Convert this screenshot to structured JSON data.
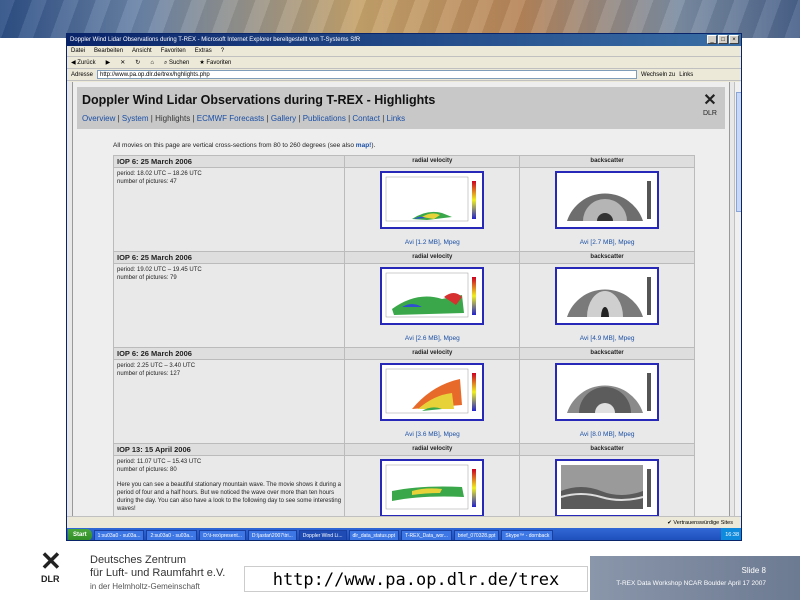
{
  "window": {
    "title": "Doppler Wind Lidar Observations during T-REX - Microsoft Internet Explorer bereitgestellt von T-Systems SfR",
    "controls": [
      "_",
      "□",
      "×"
    ]
  },
  "menu": [
    "Datei",
    "Bearbeiten",
    "Ansicht",
    "Favoriten",
    "Extras",
    "?"
  ],
  "toolbar": {
    "back": "Zurück",
    "search": "Suchen",
    "favorites": "Favoriten"
  },
  "address": {
    "label": "Adresse",
    "url": "http://www.pa.op.dlr.de/trex/hghlights.php",
    "go": "Wechseln zu",
    "links": "Links"
  },
  "page": {
    "title": "Doppler Wind Lidar Observations during T-REX - Highlights",
    "nav": [
      "Overview",
      "System",
      "Highlights",
      "ECMWF Forecasts",
      "Gallery",
      "Publications",
      "Contact",
      "Links"
    ],
    "logo_text": "DLR",
    "intro": "All movies on this page are vertical cross-sections from 80 to 260 degrees (see also",
    "intro_link": "map!",
    "intro_end": ").",
    "col_radial": "radial velocity",
    "col_backscatter": "backscatter",
    "iops": [
      {
        "name": "IOP 6: 25 March 2006",
        "period": "period: 18.02 UTC – 18.26 UTC",
        "pictures": "number of pictures: 47",
        "note": "",
        "radial_avi": "Avi [1.2 MB]",
        "back_avi": "Avi [2.7 MB]",
        "mpeg": "Mpeg"
      },
      {
        "name": "IOP 6: 25 March 2006",
        "period": "period: 19.02 UTC – 19.45 UTC",
        "pictures": "number of pictures: 79",
        "note": "",
        "radial_avi": "Avi [2.6 MB]",
        "back_avi": "Avi [4.9 MB]",
        "mpeg": "Mpeg"
      },
      {
        "name": "IOP 6: 26 March 2006",
        "period": "period: 2.25 UTC – 3.40 UTC",
        "pictures": "number of pictures: 127",
        "note": "",
        "radial_avi": "Avi [3.6 MB]",
        "back_avi": "Avi [8.0 MB]",
        "mpeg": "Mpeg"
      },
      {
        "name": "IOP 13: 15 April 2006",
        "period": "period: 11.07 UTC – 15.43 UTC",
        "pictures": "number of pictures: 80",
        "note": "Here you can see a beautiful stationary mountain wave. The movie shows it during a period of four and a half hours. But we noticed the wave over more than ten hours during the day. You can also have a look to the following day to see some interesting waves!",
        "radial_avi": "",
        "back_avi": "",
        "mpeg": ""
      }
    ]
  },
  "status": {
    "zone": "Vertrauenswürdige Sites"
  },
  "taskbar": {
    "start": "Start",
    "items": [
      "1:su03a0 - su03a...",
      "2:su03a0 - su03a...",
      "D:\\t-rex\\present...",
      "D:\\jastar\\2007\\tri...",
      "Doppler Wind Li...",
      "dlr_data_status.ppt",
      "T-REX_Data_wor...",
      "brief_070328.ppt",
      "Skype™ - dornback"
    ],
    "active_index": 4,
    "time": "16:38"
  },
  "footer": {
    "logo_mark": "DLR",
    "org_line1": "Deutsches Zentrum",
    "org_line2": "für Luft- und Raumfahrt e.V.",
    "org_line3": "in der Helmholtz-Gemeinschaft",
    "url": "http://www.pa.op.dlr.de/trex",
    "slide": "Slide 8",
    "workshop": "T-REX Data Workshop NCAR Boulder April 17 2007"
  },
  "colors": {
    "link": "#1a4fa5",
    "thumb_border": "#2727b8",
    "titlebar": "#0a246a"
  }
}
